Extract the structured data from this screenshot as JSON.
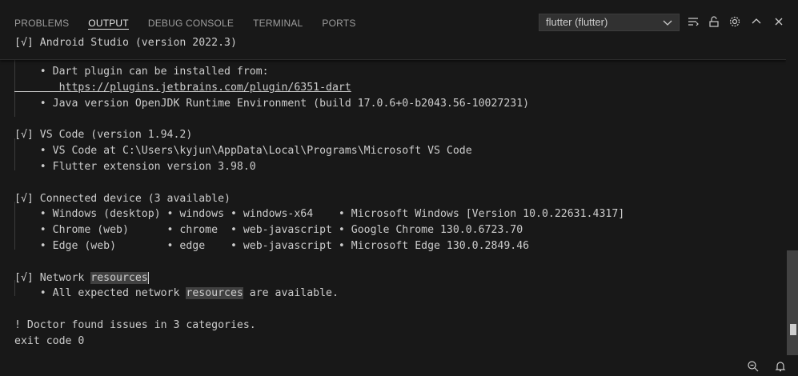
{
  "tabs": [
    {
      "label": "PROBLEMS"
    },
    {
      "label": "OUTPUT"
    },
    {
      "label": "DEBUG CONSOLE"
    },
    {
      "label": "TERMINAL"
    },
    {
      "label": "PORTS"
    }
  ],
  "active_tab": "OUTPUT",
  "channel_select": {
    "value": "flutter (flutter)"
  },
  "output": {
    "sticky": "[√] Android Studio (version 2022.3)",
    "lines": [
      {
        "text": "    • Dart plugin can be installed from:"
      },
      {
        "text": "       https://plugins.jetbrains.com/plugin/6351-dart"
      },
      {
        "text": "    • Java version OpenJDK Runtime Environment (build 17.0.6+0-b2043.56-10027231)"
      },
      {
        "text": ""
      },
      {
        "text": "[√] VS Code (version 1.94.2)"
      },
      {
        "text": "    • VS Code at C:\\Users\\kyjun\\AppData\\Local\\Programs\\Microsoft VS Code"
      },
      {
        "text": "    • Flutter extension version 3.98.0"
      },
      {
        "text": ""
      },
      {
        "text": "[√] Connected device (3 available)"
      },
      {
        "text": "    • Windows (desktop) • windows • windows-x64    • Microsoft Windows [Version 10.0.22631.4317]"
      },
      {
        "text": "    • Chrome (web)      • chrome  • web-javascript • Google Chrome 130.0.6723.70"
      },
      {
        "text": "    • Edge (web)        • edge    • web-javascript • Microsoft Edge 130.0.2849.46"
      },
      {
        "text": ""
      },
      {
        "pre": "[√] Network ",
        "hl": "resources",
        "post": ""
      },
      {
        "pre": "    • All expected network ",
        "hl": "resources",
        "post": " are available."
      },
      {
        "text": ""
      },
      {
        "text": "! Doctor found issues in 3 categories."
      },
      {
        "text": "exit code 0"
      }
    ]
  }
}
